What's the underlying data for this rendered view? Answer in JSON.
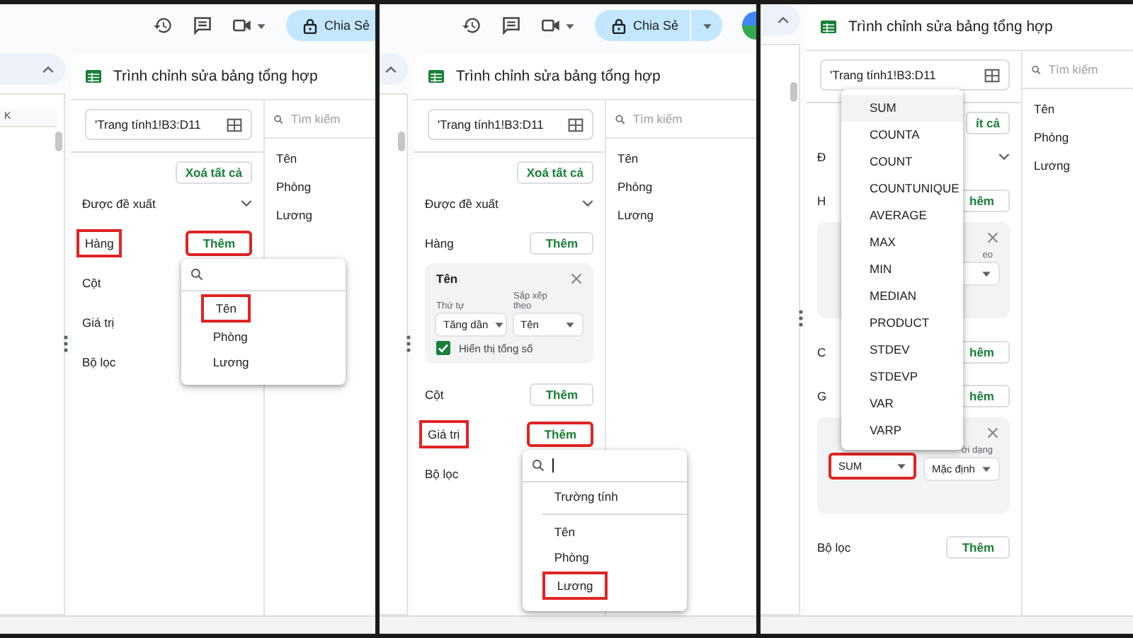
{
  "panels": [
    {
      "toolbar": {
        "share": {
          "label": "Chia Sẻ",
          "split": false
        },
        "avatar": false
      },
      "sheet": {
        "column_header": "K"
      },
      "editor": {
        "title": "Trình chỉnh sửa bảng tổng hợp",
        "range": "'Trang tính1!B3:D11",
        "clear_all": "Xoá tất cả",
        "sections": [
          {
            "label": "Được đề xuất",
            "expanded": false
          },
          {
            "label": "Hàng",
            "label_highlighted": true,
            "add": {
              "label": "Thêm",
              "highlighted": true
            },
            "menu": {
              "kind": "fields",
              "search": {
                "cursor": false
              },
              "items": [
                {
                  "label": "Tên",
                  "selected": false,
                  "highlighted": true
                },
                {
                  "label": "Phòng",
                  "selected": false,
                  "highlighted": false
                },
                {
                  "label": "Lương",
                  "selected": false,
                  "highlighted": false
                }
              ]
            }
          },
          {
            "label": "Cột"
          },
          {
            "label": "Giá trị"
          },
          {
            "label": "Bộ lọc"
          }
        ],
        "field_search": {
          "placeholder": "Tìm kiếm"
        },
        "fields": [
          "Tên",
          "Phòng",
          "Lương"
        ]
      }
    },
    {
      "toolbar": {
        "share": {
          "label": "Chia Sẻ",
          "split": true
        },
        "avatar": true
      },
      "editor": {
        "title": "Trình chỉnh sửa bảng tổng hợp",
        "range": "'Trang tính1!B3:D11",
        "clear_all": "Xoá tất cả",
        "sections": [
          {
            "label": "Được đề xuất",
            "expanded": false
          },
          {
            "label": "Hàng",
            "add": {
              "label": "Thêm",
              "highlighted": false
            },
            "card": {
              "title": "Tên",
              "fields": [
                {
                  "kind": "order",
                  "label": "Thứ tự",
                  "value": "Tăng dần"
                },
                {
                  "kind": "sortby",
                  "label": "Sắp xếp theo",
                  "value": "Tên"
                }
              ],
              "checkbox": {
                "label": "Hiển thị tổng số",
                "checked": true
              }
            }
          },
          {
            "label": "Cột",
            "add": {
              "label": "Thêm",
              "highlighted": false
            }
          },
          {
            "label": "Giá trị",
            "label_highlighted": true,
            "add": {
              "label": "Thêm",
              "highlighted": true
            },
            "menu": {
              "kind": "fields",
              "search": {
                "cursor": true
              },
              "calculated_field": "Trường tính",
              "items": [
                {
                  "label": "Tên",
                  "selected": false,
                  "highlighted": false
                },
                {
                  "label": "Phòng",
                  "selected": false,
                  "highlighted": false
                },
                {
                  "label": "Lương",
                  "selected": false,
                  "highlighted": true
                }
              ]
            }
          },
          {
            "label": "Bộ lọc"
          }
        ],
        "field_search": {
          "placeholder": "Tìm kiếm"
        },
        "fields": [
          "Tên",
          "Phòng",
          "Lương"
        ]
      }
    },
    {
      "editor": {
        "title": "Trình chỉnh sửa bảng tổng hợp",
        "range": "'Trang tính1!B3:D11",
        "clear_all": "ít cả",
        "sections": [
          {
            "label": "Đ",
            "expanded": false
          },
          {
            "label": "H",
            "add": {
              "label": "hêm",
              "highlighted": false
            },
            "card": {
              "fields": [
                {
                  "kind": "sortby",
                  "label": "eo"
                }
              ]
            }
          },
          {
            "label": "C",
            "add": {
              "label": "hêm",
              "highlighted": false
            }
          },
          {
            "label": "G",
            "add": {
              "label": "hêm",
              "highlighted": false
            },
            "card": {
              "fields": [
                {
                  "kind": "summary",
                  "value": "SUM",
                  "highlighted": true,
                  "menu": {
                    "kind": "functions",
                    "items": [
                      {
                        "label": "SUM",
                        "selected": true
                      },
                      {
                        "label": "COUNTA",
                        "selected": false
                      },
                      {
                        "label": "COUNT",
                        "selected": false
                      },
                      {
                        "label": "COUNTUNIQUE",
                        "selected": false
                      },
                      {
                        "label": "AVERAGE",
                        "selected": false
                      },
                      {
                        "label": "MAX",
                        "selected": false
                      },
                      {
                        "label": "MIN",
                        "selected": false
                      },
                      {
                        "label": "MEDIAN",
                        "selected": false
                      },
                      {
                        "label": "PRODUCT",
                        "selected": false
                      },
                      {
                        "label": "STDEV",
                        "selected": false
                      },
                      {
                        "label": "STDEVP",
                        "selected": false
                      },
                      {
                        "label": "VAR",
                        "selected": false
                      },
                      {
                        "label": "VARP",
                        "selected": false
                      }
                    ]
                  }
                },
                {
                  "kind": "showas",
                  "label": "ới dạng",
                  "value": "Mặc định"
                }
              ]
            }
          },
          {
            "label": "Bộ lọc",
            "add": {
              "label": "Thêm",
              "highlighted": false
            }
          }
        ],
        "field_search": {
          "placeholder": "Tìm kiếm"
        },
        "fields": [
          "Tên",
          "Phòng",
          "Lương"
        ]
      }
    }
  ]
}
